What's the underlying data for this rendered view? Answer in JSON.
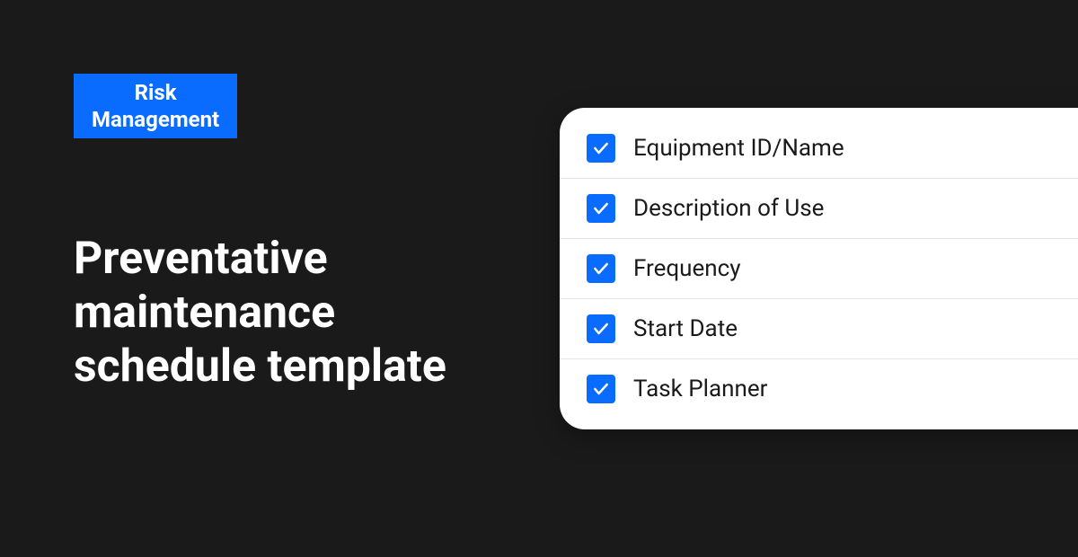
{
  "tag": {
    "line1": "Risk",
    "line2": "Management"
  },
  "heading": "Preventative maintenance schedule template",
  "checklist": {
    "items": [
      {
        "label": "Equipment ID/Name",
        "checked": true
      },
      {
        "label": "Description of Use",
        "checked": true
      },
      {
        "label": "Frequency",
        "checked": true
      },
      {
        "label": "Start Date",
        "checked": true
      },
      {
        "label": "Task Planner",
        "checked": true
      }
    ]
  },
  "colors": {
    "accent": "#0a6bff",
    "background": "#1a1a1a",
    "card": "#ffffff"
  }
}
